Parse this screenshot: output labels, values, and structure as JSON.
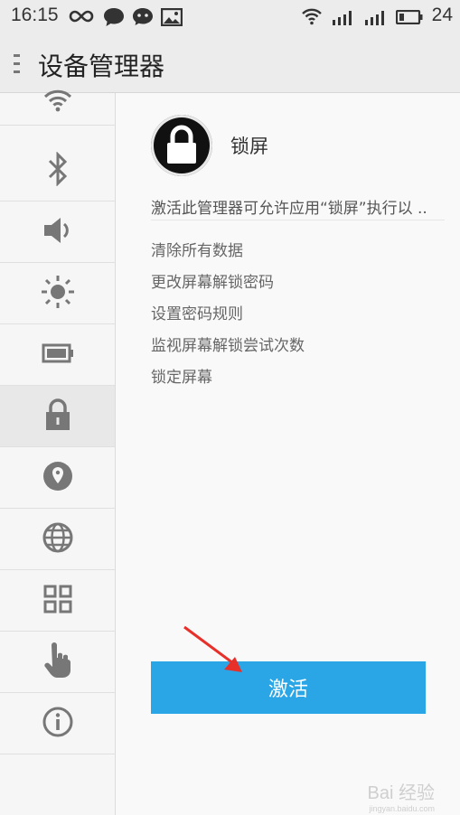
{
  "status_bar": {
    "time": "16:15",
    "battery": "24",
    "icons": [
      "infinity-icon",
      "chat-bubble-icon",
      "wechat-icon",
      "image-icon",
      "wifi-icon",
      "signal-icon",
      "signal-icon",
      "battery-icon"
    ]
  },
  "header": {
    "title": "设备管理器",
    "menu_icon": "menu-dots-icon"
  },
  "sidebar": {
    "items": [
      {
        "icon": "wifi-icon",
        "active": false
      },
      {
        "icon": "bluetooth-icon",
        "active": false
      },
      {
        "icon": "volume-icon",
        "active": false
      },
      {
        "icon": "brightness-icon",
        "active": false
      },
      {
        "icon": "battery-icon",
        "active": false
      },
      {
        "icon": "lock-icon",
        "active": true
      },
      {
        "icon": "location-icon",
        "active": false
      },
      {
        "icon": "globe-icon",
        "active": false
      },
      {
        "icon": "apps-grid-icon",
        "active": false
      },
      {
        "icon": "hand-pointer-icon",
        "active": false
      },
      {
        "icon": "info-icon",
        "active": false
      }
    ]
  },
  "main": {
    "app_name": "锁屏",
    "description": "激活此管理器可允许应用“锁屏”执行以 ..",
    "permissions": [
      "清除所有数据",
      "更改屏幕解锁密码",
      "设置密码规则",
      "监视屏幕解锁尝试次数",
      "锁定屏幕"
    ],
    "activate_label": "激活"
  },
  "watermark": {
    "text": "Bai 经验",
    "sub": "jingyan.baidu.com"
  },
  "colors": {
    "accent": "#2aa6e6",
    "arrow": "#e8302a"
  }
}
